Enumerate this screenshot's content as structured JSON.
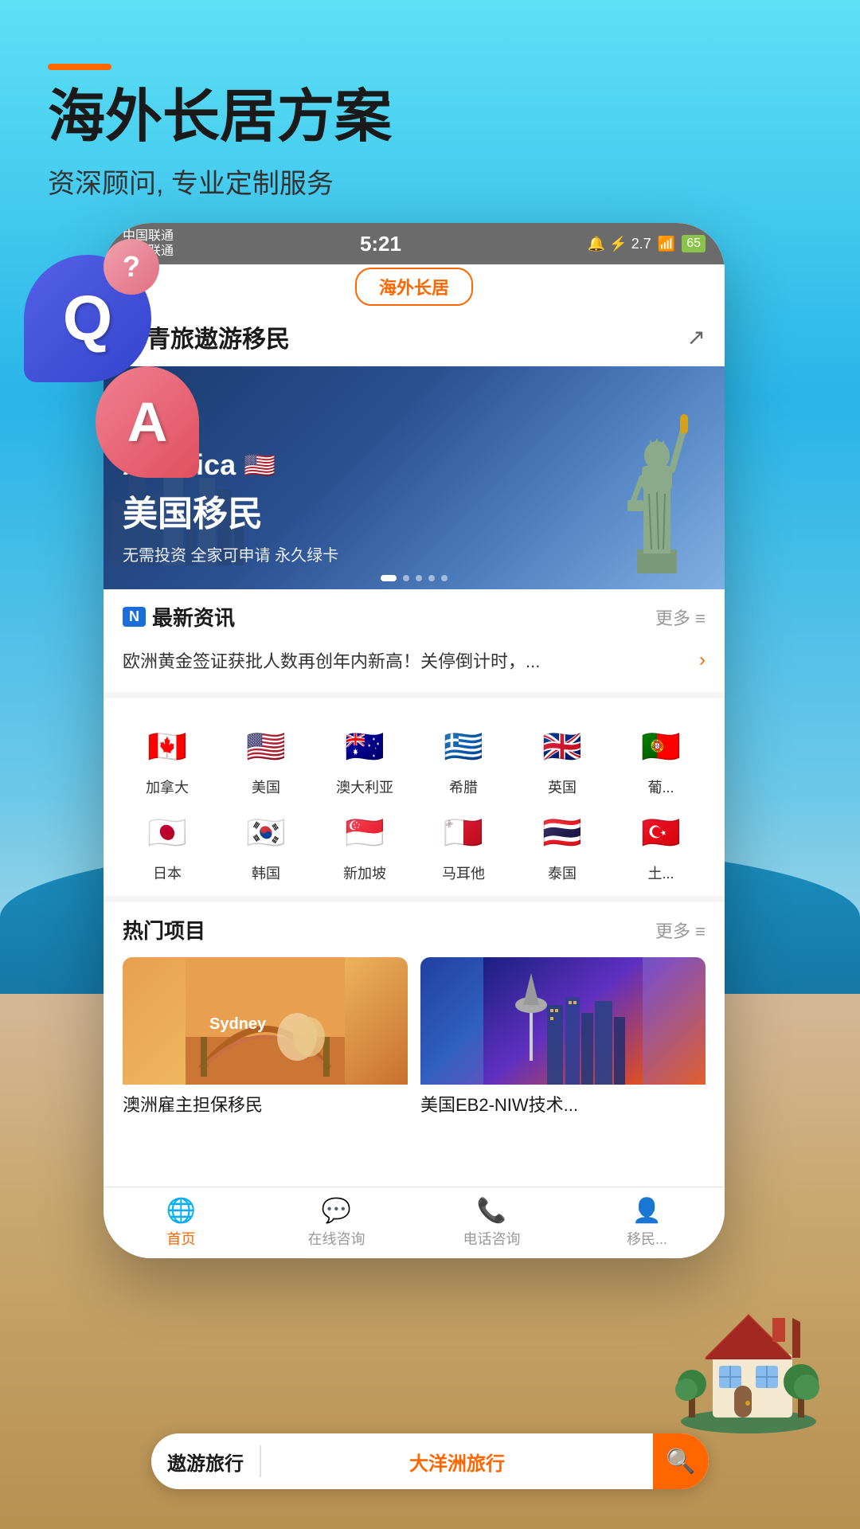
{
  "background": {
    "gradient_top": "#4dd8f0",
    "gradient_bottom": "#b8955a"
  },
  "top_section": {
    "orange_bar": true,
    "headline": "海外长居方案",
    "subheadline": "资深顾问, 专业定制服务"
  },
  "qa_decoration": {
    "q_letter": "Q",
    "a_letter": "A",
    "question_mark": "?"
  },
  "overseas_tag": "海外长居",
  "status_bar": {
    "carrier1": "中国联通",
    "carrier2": "中国联通",
    "time": "5:21",
    "signal_info": "2.7 M/s",
    "battery": "65"
  },
  "app_header": {
    "title": "中青旅遨游移民",
    "share_icon": "↗"
  },
  "banner": {
    "title_en": "America",
    "flag": "🇺🇸",
    "title_cn": "美国移民",
    "subtitle": "无需投资 全家可申请 永久绿卡",
    "dots": [
      true,
      false,
      false,
      false,
      false
    ]
  },
  "news_section": {
    "badge": "N",
    "title": "最新资讯",
    "more_text": "更多 ≡",
    "news_text": "欧洲黄金签证获批人数再创年内新高！关停倒计时，..."
  },
  "countries": [
    {
      "name": "加拿大",
      "flag": "🇨🇦"
    },
    {
      "name": "美国",
      "flag": "🇺🇸"
    },
    {
      "name": "澳大利亚",
      "flag": "🇦🇺"
    },
    {
      "name": "希腊",
      "flag": "🇬🇷"
    },
    {
      "name": "英国",
      "flag": "🇬🇧"
    },
    {
      "name": "葡...",
      "flag": "🇵🇹"
    },
    {
      "name": "日本",
      "flag": "🇯🇵"
    },
    {
      "name": "韩国",
      "flag": "🇰🇷"
    },
    {
      "name": "新加坡",
      "flag": "🇸🇬"
    },
    {
      "name": "马耳他",
      "flag": "🇲🇹"
    },
    {
      "name": "泰国",
      "flag": "🇹🇭"
    },
    {
      "name": "土...",
      "flag": "🇹🇷"
    }
  ],
  "hot_projects": {
    "title": "热门项目",
    "more_text": "更多 ≡",
    "cards": [
      {
        "title": "澳洲雇主担保移民",
        "emoji": "🌉"
      },
      {
        "title": "美国EB2-NIW技术...",
        "emoji": "🌃"
      }
    ]
  },
  "bottom_nav": [
    {
      "label": "首页",
      "icon": "🌐",
      "active": true
    },
    {
      "label": "在线咨询",
      "icon": "💬",
      "active": false
    },
    {
      "label": "电话咨询",
      "icon": "📞",
      "active": false
    },
    {
      "label": "移民...",
      "icon": "👤",
      "active": false
    }
  ],
  "bottom_search": {
    "brand": "遨游旅行",
    "search_text": "大洋洲旅行",
    "search_icon": "🔍"
  }
}
